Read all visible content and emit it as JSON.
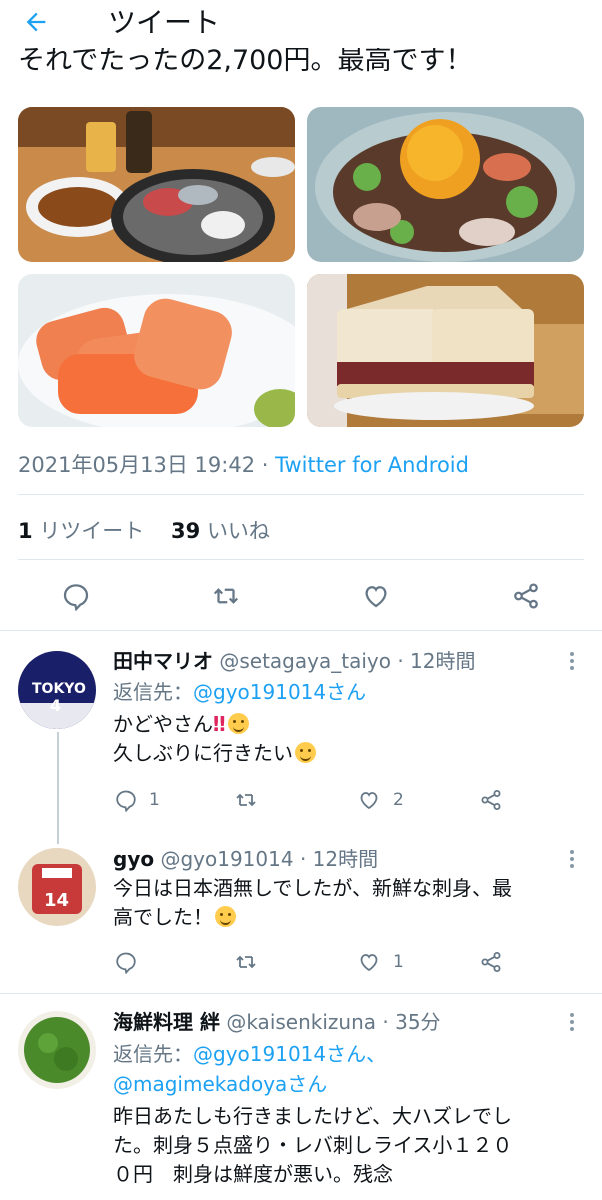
{
  "header": {
    "back_icon": "arrow-left-icon",
    "title": "ツイート"
  },
  "tweet": {
    "text_cut": "それでたったの2,700円。最高です！",
    "photos": [
      "food-photo-sashimi-plate",
      "food-photo-sashimi-bowl",
      "food-photo-salmon",
      "food-photo-katsu-sandwich"
    ],
    "timestamp": "2021年05月13日 19:42",
    "separator": "·",
    "source": "Twitter for Android",
    "retweet_count": "1",
    "retweet_label": "リツイート",
    "like_count": "39",
    "like_label": "いいね"
  },
  "replies": [
    {
      "name": "田中マリオ",
      "handle": "@setagaya_taiyo",
      "time": "· 12時間",
      "reply_to_label": "返信先：",
      "reply_to": "@gyo191014さん",
      "line1": "かどやさん",
      "line1_mark": "‼",
      "line2": "久しぶりに行きたい",
      "reply_count": "1",
      "like_count": "2"
    },
    {
      "name": "gyo",
      "handle": "@gyo191014",
      "time": "· 12時間",
      "line1": "今日は日本酒無しでしたが、新鮮な刺身、最",
      "line2": "高でした！",
      "like_count": "1"
    },
    {
      "name": "海鮮料理 絆",
      "handle": "@kaisenkizuna",
      "time": "· 35分",
      "reply_to_label": "返信先：",
      "reply_to": "@gyo191014さん、",
      "reply_to2": "@magimekadoyaさん",
      "line1": "昨日あたしも行きましたけど、大ハズレでし",
      "line2": "た。刺身５点盛り・レバ刺しライス小１２０",
      "line3": "０円　刺身は鮮度が悪い。残念"
    }
  ],
  "colors": {
    "accent": "#1da1f2",
    "secondary_text": "#657786",
    "divider": "#e1e8ed"
  }
}
